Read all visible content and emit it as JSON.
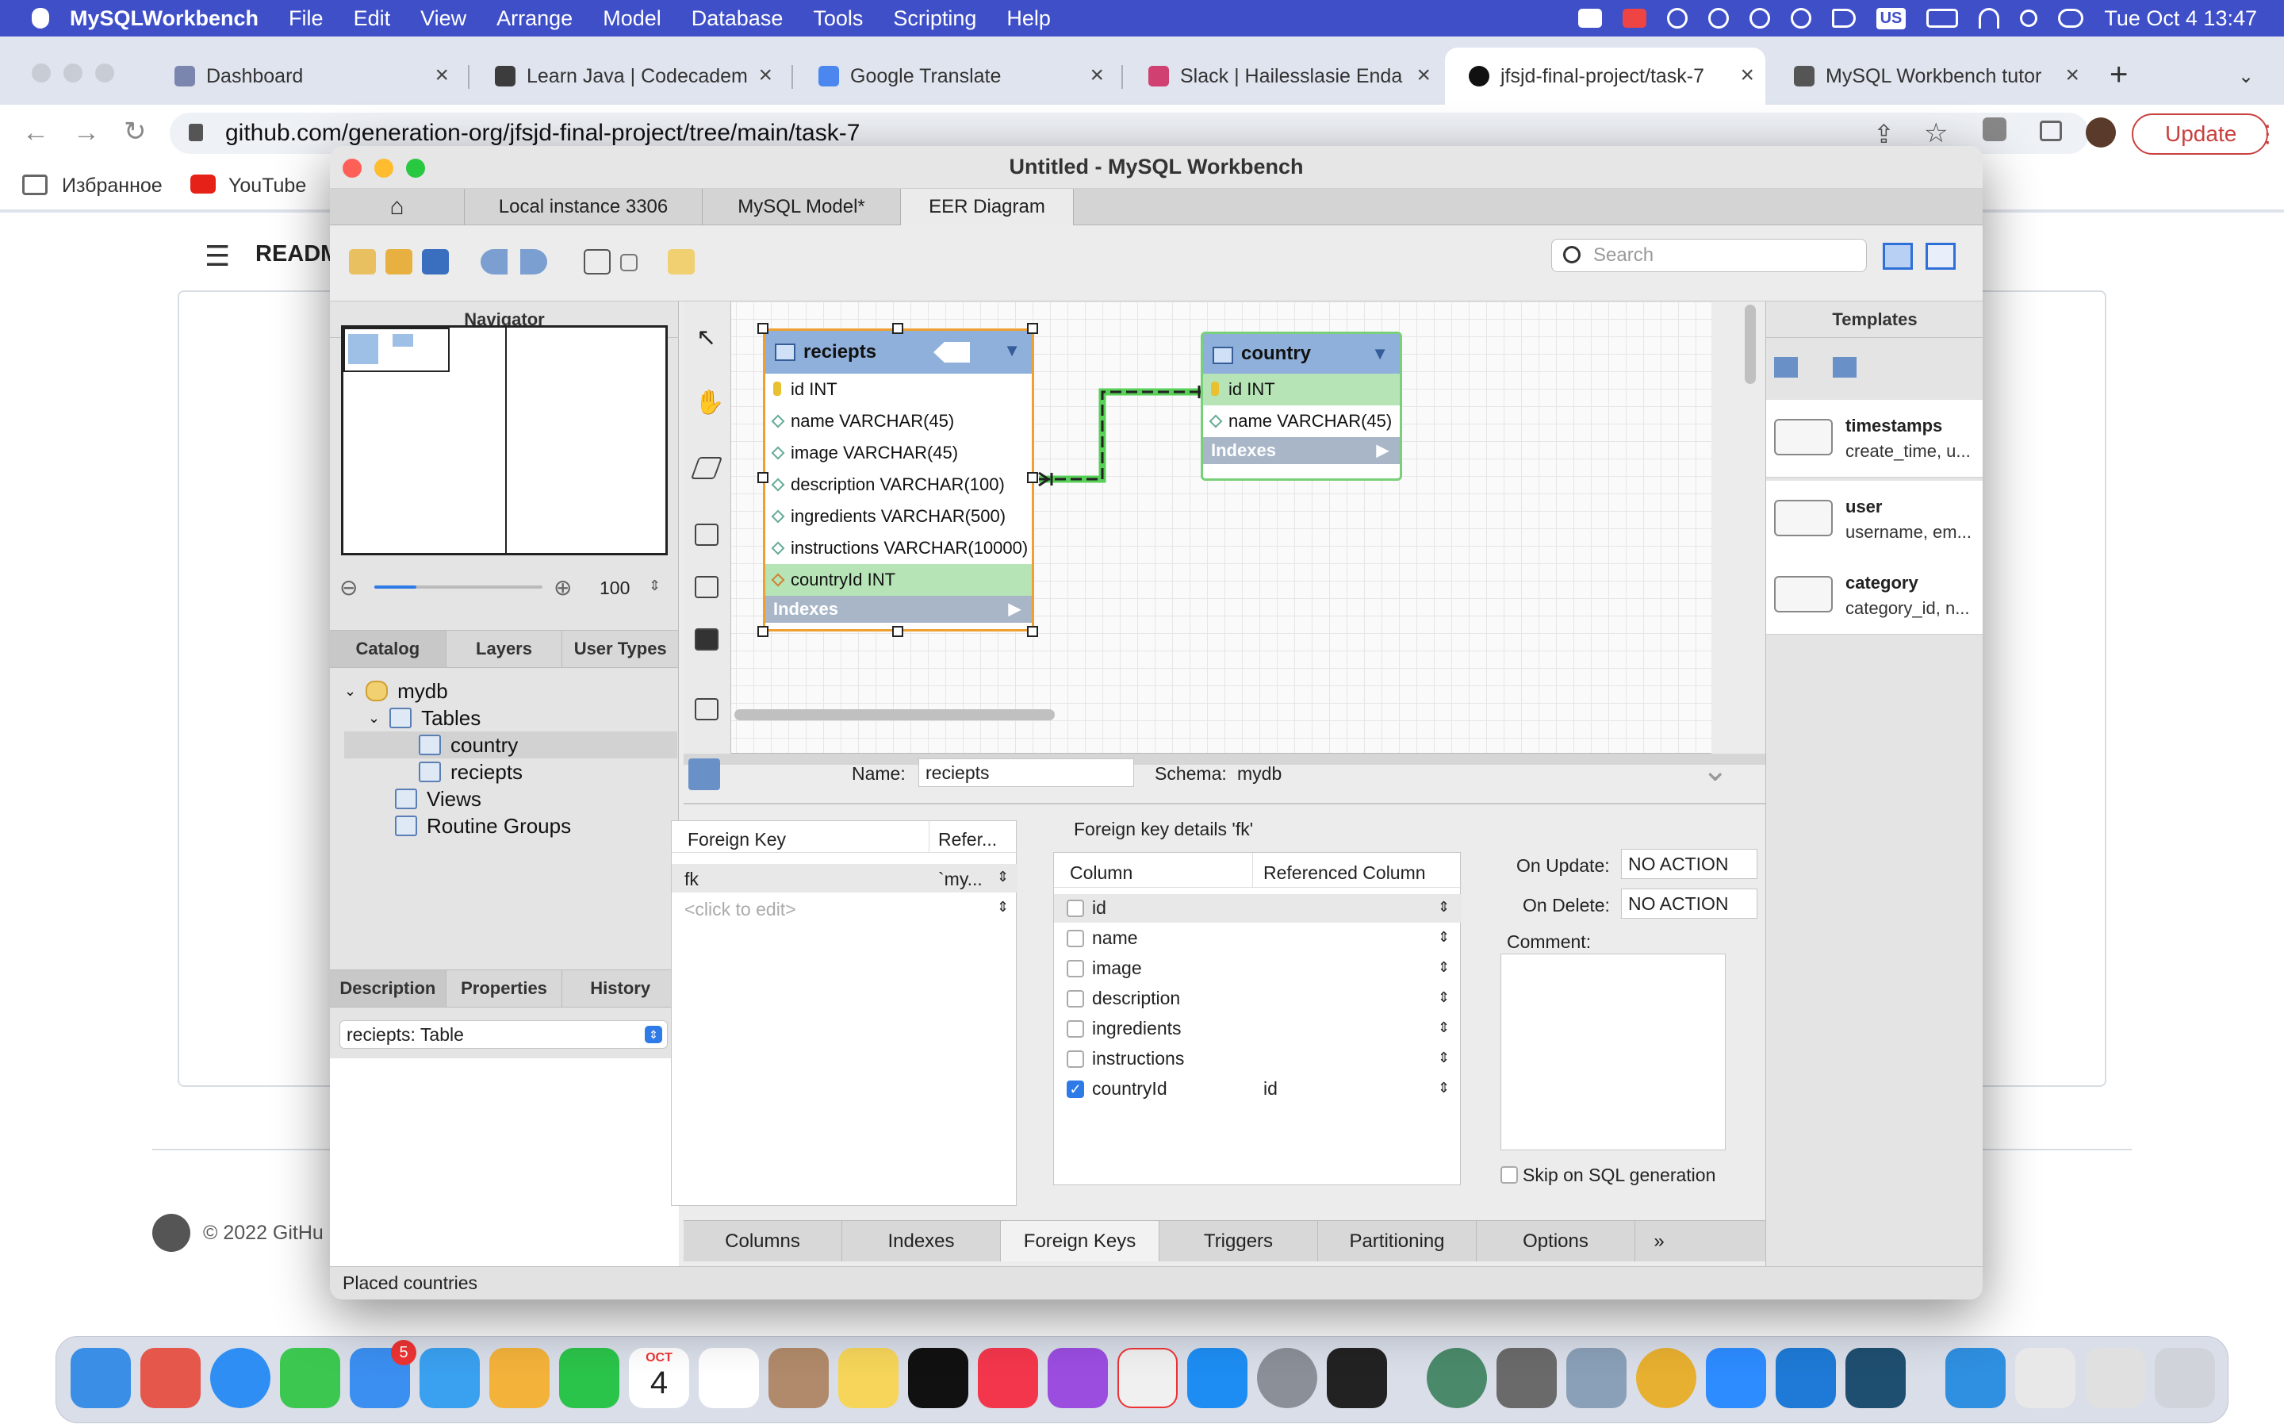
{
  "menubar": {
    "app": "MySQLWorkbench",
    "items": [
      "File",
      "Edit",
      "View",
      "Arrange",
      "Model",
      "Database",
      "Tools",
      "Scripting",
      "Help"
    ],
    "input_source": "US",
    "clock": "Tue Oct 4  13:47"
  },
  "browser": {
    "tabs": [
      "Dashboard",
      "Learn Java | Codecadem",
      "Google Translate",
      "Slack | Hailesslasie Enda",
      "jfsjd-final-project/task-7",
      "MySQL Workbench tutor"
    ],
    "url": "github.com/generation-org/jfsjd-final-project/tree/main/task-7",
    "update": "Update",
    "bookmarks": [
      "Избранное",
      "YouTube"
    ]
  },
  "github": {
    "readme": "READM",
    "footer": "© 2022 GitHu"
  },
  "window": {
    "title": "Untitled - MySQL Workbench",
    "tabs": [
      "Local instance 3306",
      "MySQL Model*",
      "EER Diagram"
    ],
    "search_placeholder": "Search"
  },
  "navigator": {
    "title": "Navigator",
    "zoom": "100"
  },
  "catalog": {
    "tabs": [
      "Catalog",
      "Layers",
      "User Types"
    ],
    "db": "mydb",
    "tables_label": "Tables",
    "tables": [
      "country",
      "reciepts"
    ],
    "views": "Views",
    "routines": "Routine Groups"
  },
  "desc": {
    "tabs": [
      "Description",
      "Properties",
      "History"
    ],
    "select": "reciepts: Table"
  },
  "diagram": {
    "reciepts": {
      "name": "reciepts",
      "columns": [
        "id INT",
        "name VARCHAR(45)",
        "image VARCHAR(45)",
        "description VARCHAR(100)",
        "ingredients VARCHAR(500)",
        "instructions VARCHAR(10000)",
        "countryId INT"
      ],
      "indexes": "Indexes"
    },
    "country": {
      "name": "country",
      "columns": [
        "id INT",
        "name VARCHAR(45)"
      ],
      "indexes": "Indexes"
    }
  },
  "templates": {
    "title": "Templates",
    "items": [
      {
        "name": "timestamps",
        "desc": "create_time, u..."
      },
      {
        "name": "user",
        "desc": "username, em..."
      },
      {
        "name": "category",
        "desc": "category_id, n..."
      }
    ]
  },
  "editor": {
    "name_label": "Name:",
    "name_value": "reciepts",
    "schema_label": "Schema:",
    "schema_value": "mydb",
    "fk_header": "Foreign Key",
    "ref_header": "Refer...",
    "fk_row": "fk",
    "fk_ref": "`my...",
    "fk_placeholder": "<click to edit>",
    "details_title": "Foreign key details 'fk'",
    "col_header": "Column",
    "refcol_header": "Referenced Column",
    "columns": [
      {
        "name": "id",
        "checked": false,
        "ref": ""
      },
      {
        "name": "name",
        "checked": false,
        "ref": ""
      },
      {
        "name": "image",
        "checked": false,
        "ref": ""
      },
      {
        "name": "description",
        "checked": false,
        "ref": ""
      },
      {
        "name": "ingredients",
        "checked": false,
        "ref": ""
      },
      {
        "name": "instructions",
        "checked": false,
        "ref": ""
      },
      {
        "name": "countryId",
        "checked": true,
        "ref": "id"
      }
    ],
    "on_update_label": "On Update:",
    "on_update": "NO ACTION",
    "on_delete_label": "On Delete:",
    "on_delete": "NO ACTION",
    "comment_label": "Comment:",
    "skip_label": "Skip on SQL generation",
    "tabs": [
      "Columns",
      "Indexes",
      "Foreign Keys",
      "Triggers",
      "Partitioning",
      "Options"
    ]
  },
  "status": "Placed countries",
  "dock": {
    "calendar_month": "OCT",
    "calendar_day": "4",
    "mail_badge": "5"
  }
}
